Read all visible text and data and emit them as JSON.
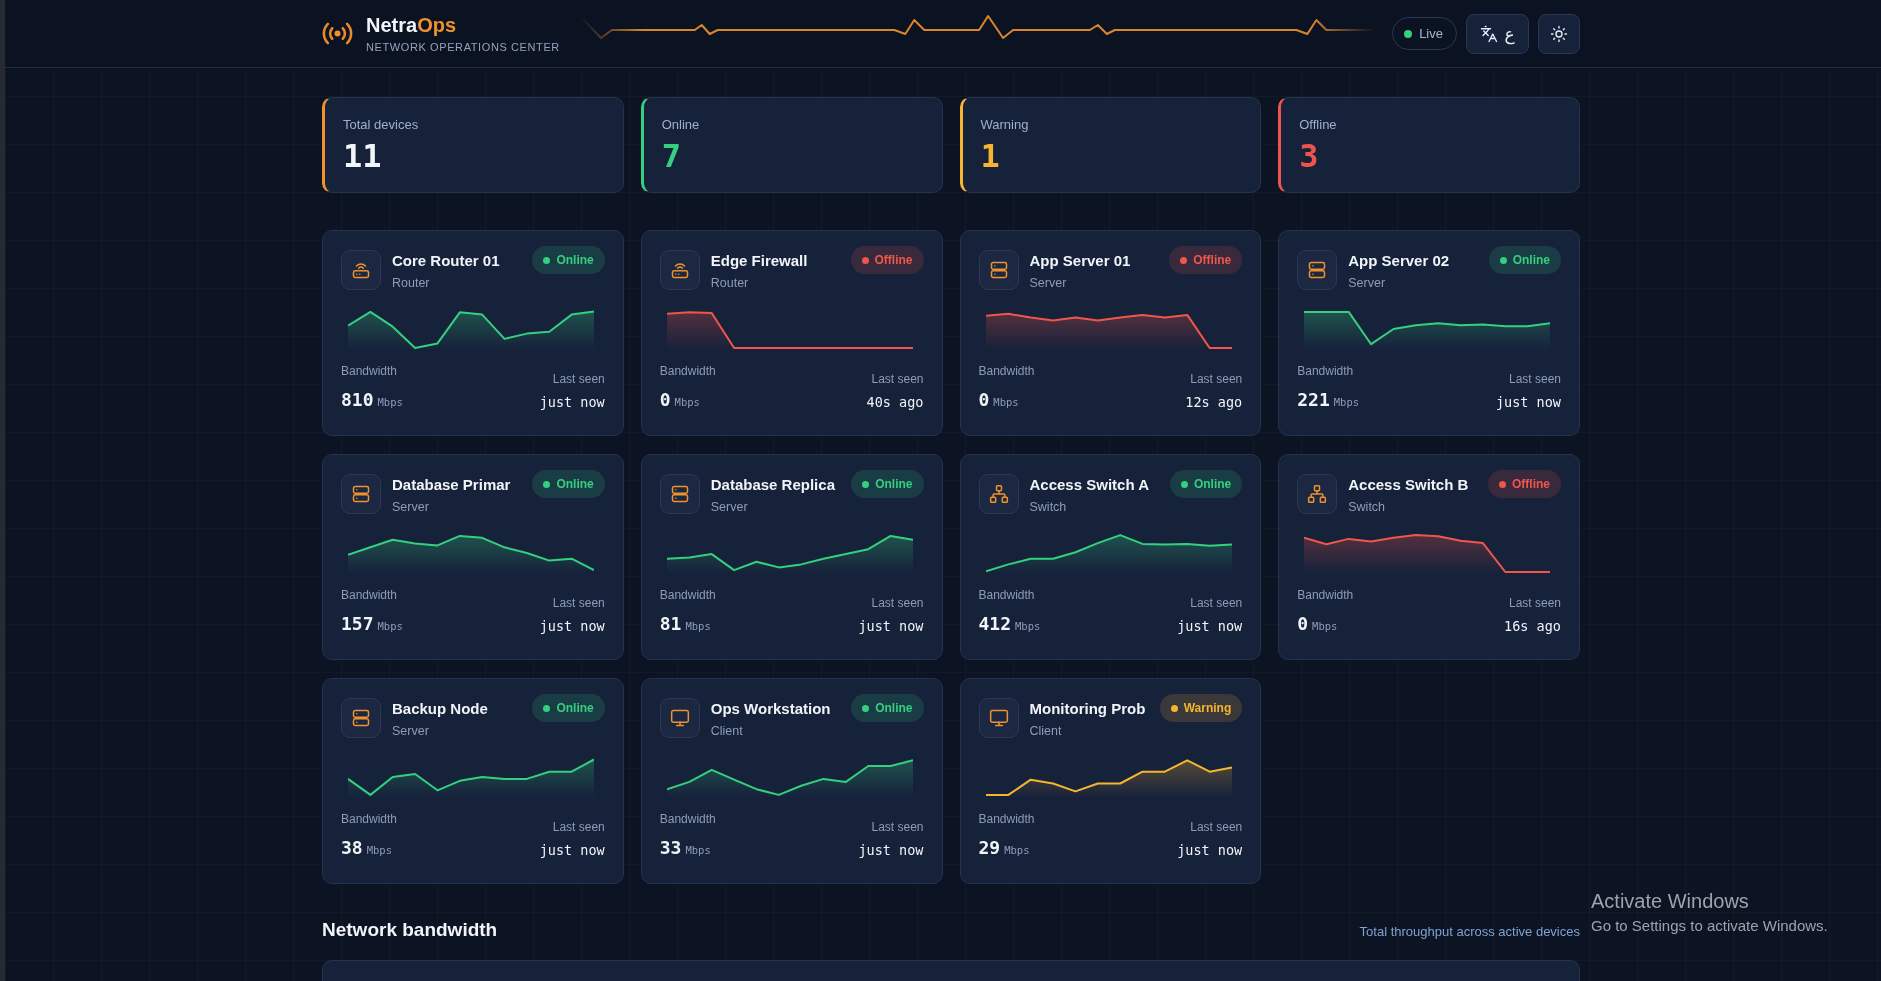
{
  "header": {
    "brand_name": "Netra",
    "brand_accent": "Ops",
    "subtitle": "NETWORK OPERATIONS CENTER",
    "live_label": "Live",
    "language_label": "ع"
  },
  "stats": [
    {
      "kind": "total",
      "label": "Total devices",
      "value": "11"
    },
    {
      "kind": "online",
      "label": "Online",
      "value": "7"
    },
    {
      "kind": "warning",
      "label": "Warning",
      "value": "1"
    },
    {
      "kind": "offline",
      "label": "Offline",
      "value": "3"
    }
  ],
  "devices": [
    {
      "name": "Core Router 01",
      "type": "Router",
      "kind": "router",
      "color": "#34d07f",
      "status_label": "Online",
      "bandwidth_label": "Bandwidth",
      "bandwidth": "810",
      "unit": "Mbps",
      "last_seen_label": "Last seen",
      "last_seen": "just now"
    },
    {
      "name": "Edge Firewall",
      "type": "Router",
      "kind": "router",
      "color": "#f0564a",
      "status_label": "Offline",
      "bandwidth_label": "Bandwidth",
      "bandwidth": "0",
      "unit": "Mbps",
      "last_seen_label": "Last seen",
      "last_seen": "40s ago"
    },
    {
      "name": "App Server 01",
      "type": "Server",
      "kind": "server",
      "color": "#f0564a",
      "status_label": "Offline",
      "bandwidth_label": "Bandwidth",
      "bandwidth": "0",
      "unit": "Mbps",
      "last_seen_label": "Last seen",
      "last_seen": "12s ago"
    },
    {
      "name": "App Server 02",
      "type": "Server",
      "kind": "server",
      "color": "#34d07f",
      "status_label": "Online",
      "bandwidth_label": "Bandwidth",
      "bandwidth": "221",
      "unit": "Mbps",
      "last_seen_label": "Last seen",
      "last_seen": "just now"
    },
    {
      "name": "Database Primar",
      "type": "Server",
      "kind": "server",
      "color": "#34d07f",
      "status_label": "Online",
      "bandwidth_label": "Bandwidth",
      "bandwidth": "157",
      "unit": "Mbps",
      "last_seen_label": "Last seen",
      "last_seen": "just now"
    },
    {
      "name": "Database Replica",
      "type": "Server",
      "kind": "server",
      "color": "#34d07f",
      "status_label": "Online",
      "bandwidth_label": "Bandwidth",
      "bandwidth": "81",
      "unit": "Mbps",
      "last_seen_label": "Last seen",
      "last_seen": "just now"
    },
    {
      "name": "Access Switch A",
      "type": "Switch",
      "kind": "switch",
      "color": "#34d07f",
      "status_label": "Online",
      "bandwidth_label": "Bandwidth",
      "bandwidth": "412",
      "unit": "Mbps",
      "last_seen_label": "Last seen",
      "last_seen": "just now"
    },
    {
      "name": "Access Switch B",
      "type": "Switch",
      "kind": "switch",
      "color": "#f0564a",
      "status_label": "Offline",
      "bandwidth_label": "Bandwidth",
      "bandwidth": "0",
      "unit": "Mbps",
      "last_seen_label": "Last seen",
      "last_seen": "16s ago"
    },
    {
      "name": "Backup Node",
      "type": "Server",
      "kind": "server",
      "color": "#34d07f",
      "status_label": "Online",
      "bandwidth_label": "Bandwidth",
      "bandwidth": "38",
      "unit": "Mbps",
      "last_seen_label": "Last seen",
      "last_seen": "just now"
    },
    {
      "name": "Ops Workstation",
      "type": "Client",
      "kind": "client",
      "color": "#34d07f",
      "status_label": "Online",
      "bandwidth_label": "Bandwidth",
      "bandwidth": "33",
      "unit": "Mbps",
      "last_seen_label": "Last seen",
      "last_seen": "just now"
    },
    {
      "name": "Monitoring Prob",
      "type": "Client",
      "kind": "client",
      "color": "#f6b530",
      "status_label": "Warning",
      "bandwidth_label": "Bandwidth",
      "bandwidth": "29",
      "unit": "Mbps",
      "last_seen_label": "Last seen",
      "last_seen": "just now"
    }
  ],
  "bandwidth_section": {
    "title": "Network bandwidth",
    "subtitle": "Total throughput across active devices"
  },
  "system_notice": {
    "title": "Activate Windows",
    "text": "Go to Settings to activate Windows."
  }
}
